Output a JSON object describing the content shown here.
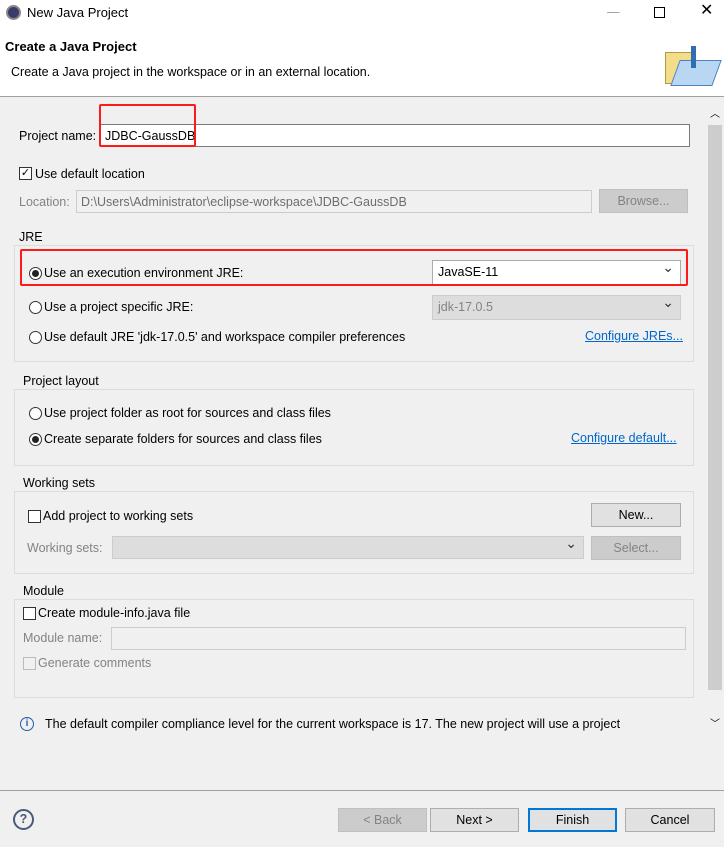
{
  "window": {
    "title": "New Java Project"
  },
  "header": {
    "title": "Create a Java Project",
    "subtitle": "Create a Java project in the workspace or in an external location."
  },
  "project_name": {
    "label": "Project name:",
    "value": "JDBC-GaussDB"
  },
  "default_location": {
    "label": "Use default location",
    "checked": true
  },
  "location": {
    "label": "Location:",
    "value": "D:\\Users\\Administrator\\eclipse-workspace\\JDBC-GaussDB",
    "browse": "Browse..."
  },
  "jre": {
    "title": "JRE",
    "option_env": "Use an execution environment JRE:",
    "env_value": "JavaSE-11",
    "option_specific": "Use a project specific JRE:",
    "specific_value": "jdk-17.0.5",
    "option_default": "Use default JRE 'jdk-17.0.5' and workspace compiler preferences",
    "configure_link": "Configure JREs...",
    "selected": "env"
  },
  "layout": {
    "title": "Project layout",
    "option_root": "Use project folder as root for sources and class files",
    "option_separate": "Create separate folders for sources and class files",
    "configure_link": "Configure default...",
    "selected": "separate"
  },
  "working_sets": {
    "title": "Working sets",
    "add_label": "Add project to working sets",
    "new_button": "New...",
    "sets_label": "Working sets:",
    "select_button": "Select..."
  },
  "module": {
    "title": "Module",
    "create_label": "Create module-info.java file",
    "name_label": "Module name:",
    "generate_label": "Generate comments"
  },
  "info": {
    "message": "The default compiler compliance level for the current workspace is 17. The new project will use a project"
  },
  "footer": {
    "back": "< Back",
    "next": "Next >",
    "finish": "Finish",
    "cancel": "Cancel"
  },
  "colors": {
    "highlight": "#ff1a1a",
    "link": "#0066cc",
    "default_button": "#0078d7"
  }
}
